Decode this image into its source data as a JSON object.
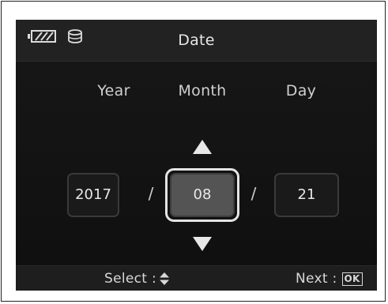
{
  "header": {
    "title": "Date",
    "battery_icon": "battery-icon",
    "card_icon": "memory-card-icon"
  },
  "date": {
    "year_label": "Year",
    "month_label": "Month",
    "day_label": "Day",
    "year_value": "2017",
    "month_value": "08",
    "day_value": "21",
    "separator": "/",
    "selected_field": "month"
  },
  "footer": {
    "select_label": "Select :",
    "select_icon": "up-down-arrows-icon",
    "next_label": "Next :",
    "next_key": "OK"
  },
  "colors": {
    "screen_bg": "#111111",
    "active_field_bg": "#545454",
    "active_ring": "#e4e4e4",
    "text": "#e6e6e6"
  }
}
